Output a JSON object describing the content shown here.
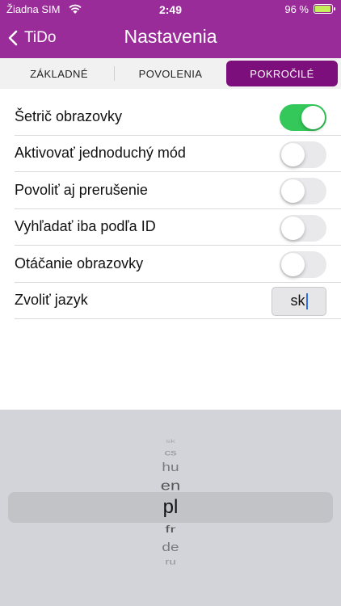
{
  "status_bar": {
    "carrier": "Žiadna SIM",
    "time": "2:49",
    "battery_percent": "96 %",
    "battery_level": 0.96,
    "wifi_icon": "wifi-icon",
    "battery_icon": "battery-charging-icon"
  },
  "nav": {
    "back_label": "TiDo",
    "back_icon": "chevron-left-icon",
    "title": "Nastavenia"
  },
  "tabs": [
    {
      "label": "ZÁKLADNÉ",
      "active": false
    },
    {
      "label": "POVOLENIA",
      "active": false
    },
    {
      "label": "POKROČILÉ",
      "active": true
    }
  ],
  "settings": [
    {
      "label": "Šetrič obrazovky",
      "on": true
    },
    {
      "label": "Aktivovať jednoduchý mód",
      "on": false
    },
    {
      "label": "Povoliť aj prerušenie",
      "on": false
    },
    {
      "label": "Vyhľadať iba podľa ID",
      "on": false
    },
    {
      "label": "Otáčanie obrazovky",
      "on": false
    }
  ],
  "language": {
    "label": "Zvoliť jazyk",
    "value": "sk"
  },
  "language_picker": {
    "options": [
      "sk",
      "cs",
      "hu",
      "en",
      "pl",
      "fr",
      "de",
      "ru"
    ],
    "selected": "pl"
  },
  "colors": {
    "header": "#9a2c99",
    "active_tab": "#7d0f7d",
    "toggle_on": "#34c759"
  }
}
